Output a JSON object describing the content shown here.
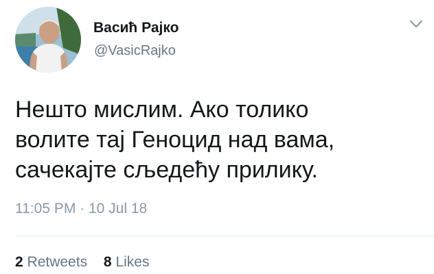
{
  "author": {
    "display_name": "Васић Рајко",
    "handle": "@VasicRajko",
    "avatar_icon": "user-avatar-photo"
  },
  "menu": {
    "icon": "chevron-down-icon",
    "color": "#8899a6"
  },
  "tweet": {
    "lines": [
      "Нешто мислим. Ако толико",
      "волите тај Геноцид над вама,",
      "сачекајте сљедећу прилику."
    ],
    "timestamp": "11:05 PM · 10 Jul 18"
  },
  "stats": {
    "retweets_count": "2",
    "retweets_label": "Retweets",
    "likes_count": "8",
    "likes_label": "Likes"
  },
  "colors": {
    "text_primary": "#14171a",
    "text_secondary": "#657786",
    "timestamp": "#8899a6",
    "divider": "#e1e8ed"
  }
}
